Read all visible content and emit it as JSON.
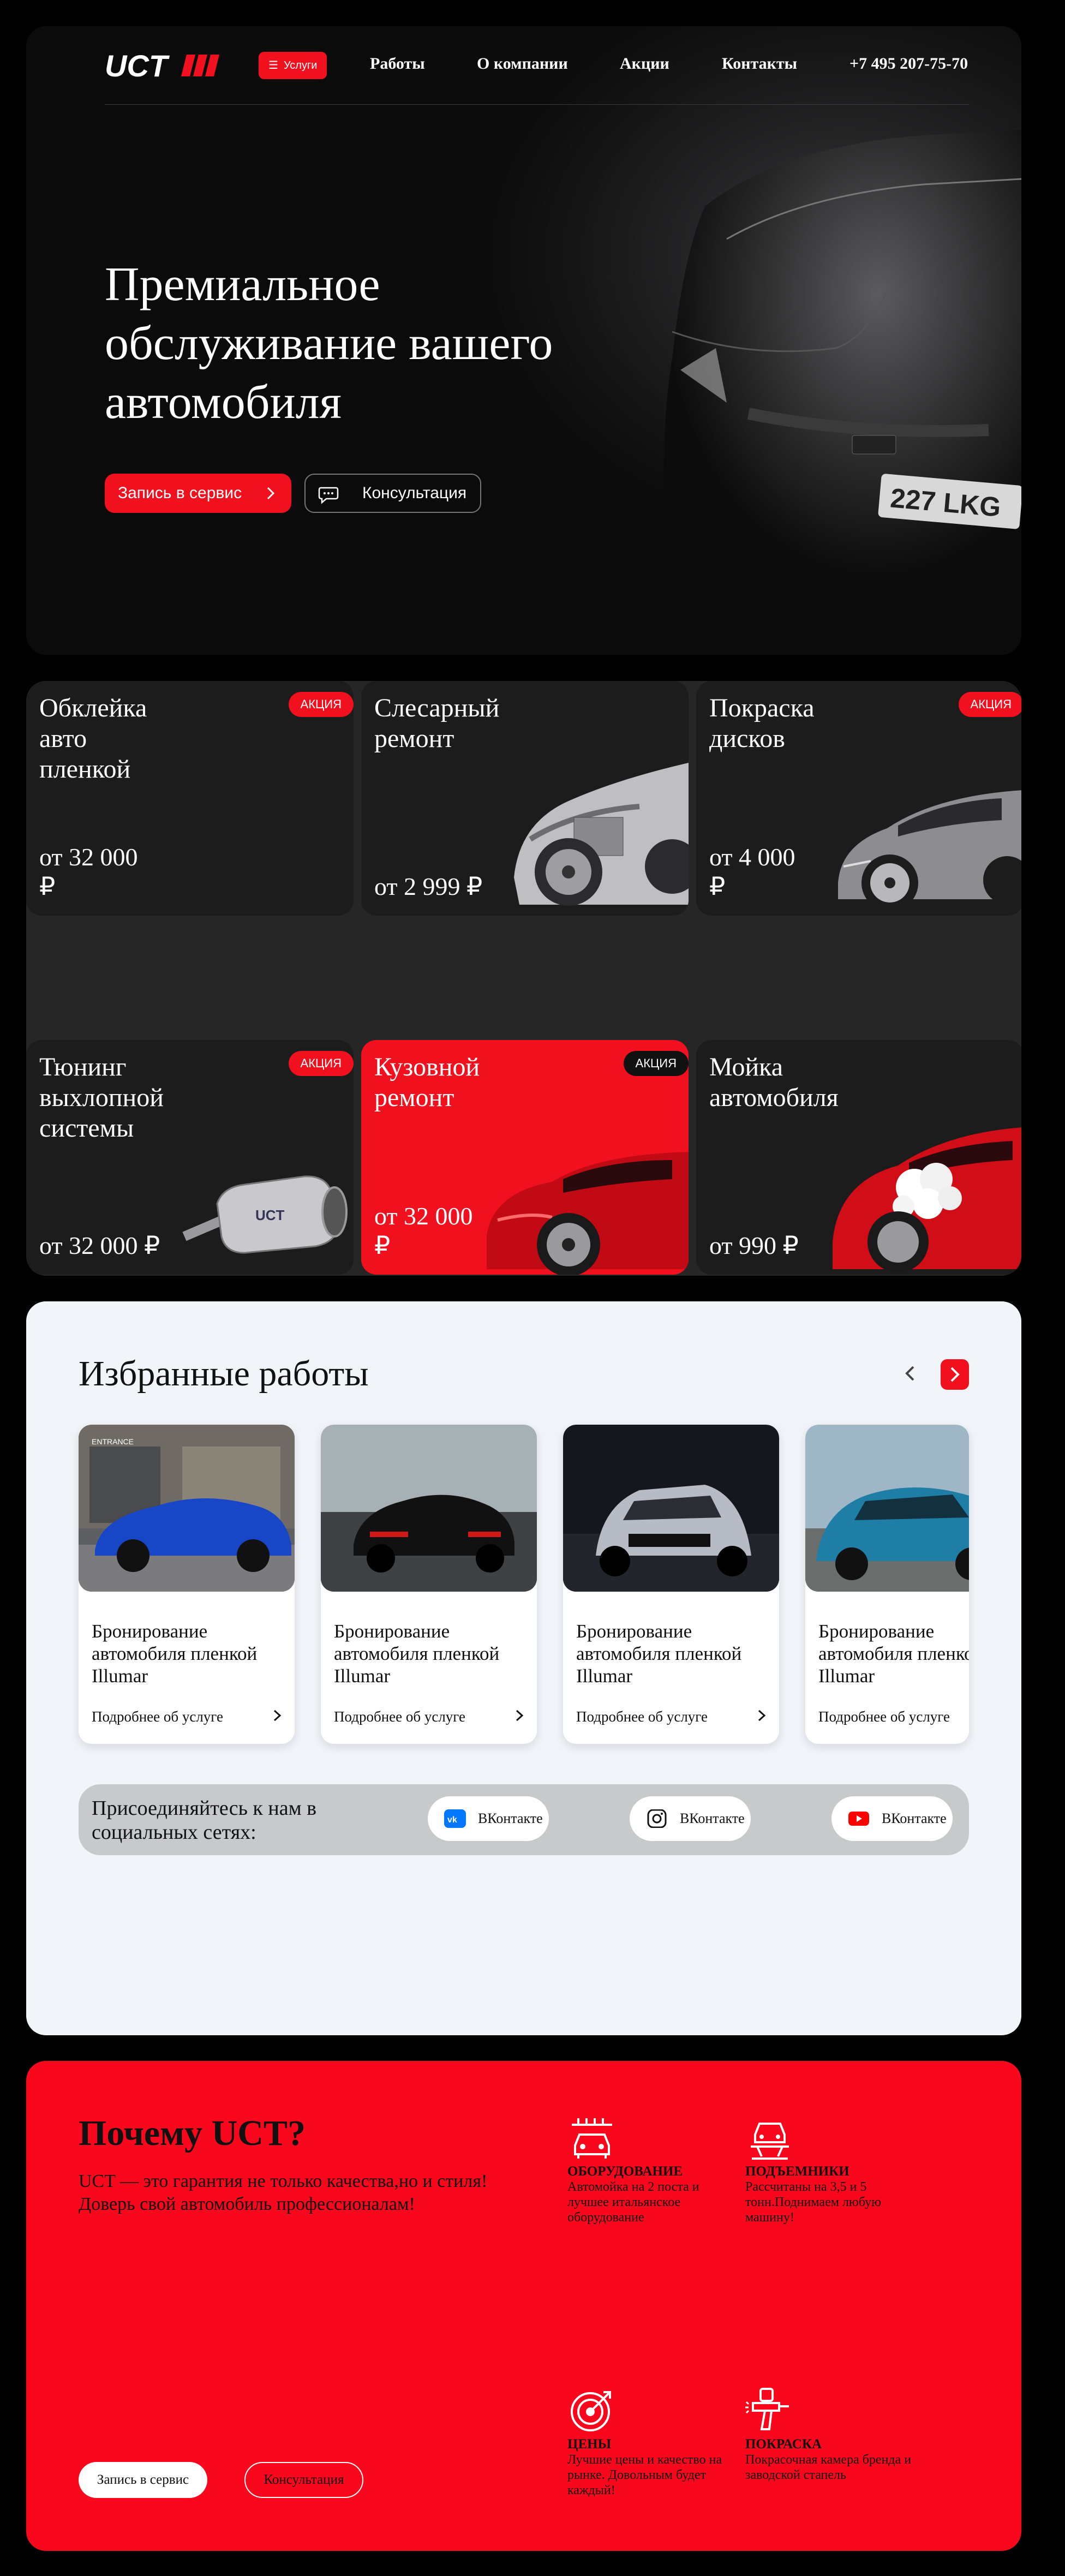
{
  "header": {
    "logo_text": "UCT",
    "services_button": "Услуги",
    "nav": [
      "Работы",
      "О компании",
      "Акции",
      "Контакты"
    ],
    "phone": "+7 495 207-75-70"
  },
  "hero": {
    "title": "Премиальное обслуживание вашего автомобиля",
    "plate_text": "227 LKG",
    "cta_primary": "Запись в сервис",
    "cta_secondary": "Консультация"
  },
  "services": [
    {
      "title": "Обклейка\nавто\nпленкой",
      "price": "от 32 000\n₽",
      "badge": "АКЦИЯ"
    },
    {
      "title": "Слесарный\nремонт",
      "price": "от 2 999 ₽",
      "badge": ""
    },
    {
      "title": "Покраска\nдисков",
      "price": "от 4 000\n₽",
      "badge": "АКЦИЯ"
    },
    {
      "title": "Тюнинг\nвыхлопной\nсистемы",
      "price": "от 32 000 ₽",
      "badge": "АКЦИЯ"
    },
    {
      "title": "Кузовной\nремонт",
      "price": "от 32 000\n₽",
      "badge": "АКЦИЯ"
    },
    {
      "title": "Мойка\nавтомобиля",
      "price": "от 990 ₽",
      "badge": ""
    }
  ],
  "works": {
    "title": "Избранные работы",
    "items": [
      {
        "title": "Бронирование автомобиля пленкой Illumar",
        "more": "Подробнее об услуге",
        "sign": "ENTRANCE"
      },
      {
        "title": "Бронирование автомобиля пленкой Illumar",
        "more": "Подробнее об услуге"
      },
      {
        "title": "Бронирование автомобиля пленкой Illumar",
        "more": "Подробнее об услуге"
      },
      {
        "title": "Бронирование автомобиля пленкой Illumar",
        "more": "Подробнее об услуге"
      }
    ],
    "social": {
      "join": "Присоединяйтесь к нам в социальных сетях:",
      "links": [
        "ВКонтакте",
        "ВКонтакте",
        "ВКонтакте"
      ]
    }
  },
  "why": {
    "title": "Почему UCT?",
    "lead": "UCT — это гарантия не только качества,но и стиля! Доверь свой автомобиль профессионалам!",
    "features": [
      {
        "title": "ОБОРУДОВАНИЕ",
        "text": "Автомойка на 2 поста и лучшее итальянское оборудование"
      },
      {
        "title": "ПОДЪЕМНИКИ",
        "text": "Рассчитаны на 3,5 и 5 тонн.Поднимаем любую машину!"
      },
      {
        "title": "ЦЕНЫ",
        "text": "Лучшие цены и качество на рынке. Довольным будет каждый!"
      },
      {
        "title": "ПОКРАСКА",
        "text": "Покрасочная камера бренда и заводской стапель"
      }
    ],
    "button_primary": "Запись в сервис",
    "button_secondary": "Консультация"
  },
  "colors": {
    "accent": "#f0101e",
    "dark": "#1c1c1d",
    "light_panel": "#f1f5fa"
  }
}
